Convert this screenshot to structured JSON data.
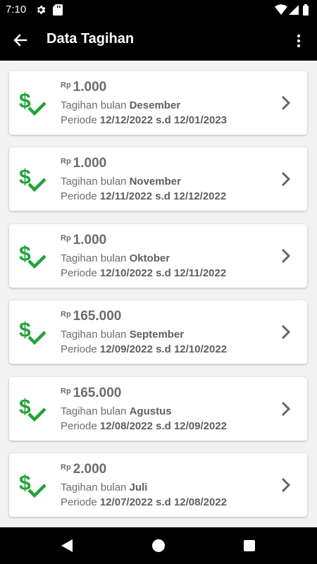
{
  "status_bar": {
    "time": "7:10"
  },
  "app_bar": {
    "title": "Data Tagihan"
  },
  "colors": {
    "accent_green": "#22a33a",
    "text_gray": "#6d6d6d",
    "bar_black": "#000000"
  },
  "icons": {
    "card": "dollar-check-icon",
    "back": "arrow-left-icon",
    "more": "more-vert-icon",
    "chevron": "chevron-right-icon"
  },
  "bills": [
    {
      "currency": "Rp",
      "amount": "1.000",
      "month_prefix": "Tagihan bulan",
      "month": "Desember",
      "period_prefix": "Periode",
      "period": "12/12/2022 s.d 12/01/2023"
    },
    {
      "currency": "Rp",
      "amount": "1.000",
      "month_prefix": "Tagihan bulan",
      "month": "November",
      "period_prefix": "Periode",
      "period": "12/11/2022 s.d 12/12/2022"
    },
    {
      "currency": "Rp",
      "amount": "1.000",
      "month_prefix": "Tagihan bulan",
      "month": "Oktober",
      "period_prefix": "Periode",
      "period": "12/10/2022 s.d 12/11/2022"
    },
    {
      "currency": "Rp",
      "amount": "165.000",
      "month_prefix": "Tagihan bulan",
      "month": "September",
      "period_prefix": "Periode",
      "period": "12/09/2022 s.d 12/10/2022"
    },
    {
      "currency": "Rp",
      "amount": "165.000",
      "month_prefix": "Tagihan bulan",
      "month": "Agustus",
      "period_prefix": "Periode",
      "period": "12/08/2022 s.d 12/09/2022"
    },
    {
      "currency": "Rp",
      "amount": "2.000",
      "month_prefix": "Tagihan bulan",
      "month": "Juli",
      "period_prefix": "Periode",
      "period": "12/07/2022 s.d 12/08/2022"
    }
  ]
}
